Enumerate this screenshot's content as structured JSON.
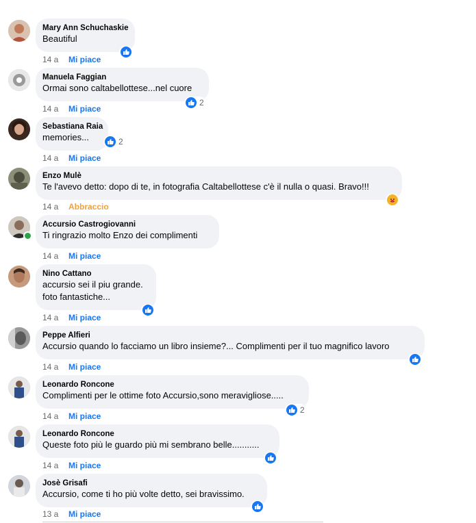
{
  "comments": [
    {
      "author": "Mary Ann Schuchaskie",
      "text": [
        "Beautiful"
      ],
      "time": "14 a",
      "action": "Mi piace",
      "reaction_count": "",
      "avatar_color": "#c9a48b"
    },
    {
      "author": "Manuela Faggian",
      "text": [
        "Ormai sono caltabellottese...nel cuore"
      ],
      "time": "14 a",
      "action": "Mi piace",
      "reaction_count": "2",
      "avatar_color": "#d8d8d8"
    },
    {
      "author": "Sebastiana Raia",
      "text": [
        "memories..."
      ],
      "time": "14 a",
      "action": "Mi piace",
      "reaction_count": "2",
      "avatar_color": "#6b4a3a"
    },
    {
      "author": "Enzo Mulè",
      "text": [
        "Te l'avevo detto: dopo di te, in fotografia Caltabellottese c'è il nulla o quasi. Bravo!!!"
      ],
      "time": "14 a",
      "action": "Abbraccio",
      "reaction_count": "",
      "avatar_color": "#7b7f6a"
    },
    {
      "author": "Accursio Castrogiovanni",
      "text": [
        "Ti ringrazio molto Enzo dei complimenti"
      ],
      "time": "14 a",
      "action": "Mi piace",
      "reaction_count": "",
      "avatar_color": "#5d5a57"
    },
    {
      "author": "Nino Cattano",
      "text": [
        "accursio sei il piu grande.",
        "foto fantastiche..."
      ],
      "time": "14 a",
      "action": "Mi piace",
      "reaction_count": "",
      "avatar_color": "#b98b6e"
    },
    {
      "author": "Peppe Alfieri",
      "text": [
        "Accursio quando lo facciamo un libro insieme?... Complimenti per il tuo magnifico lavoro"
      ],
      "time": "14 a",
      "action": "Mi piace",
      "reaction_count": "",
      "avatar_color": "#6e6e6e"
    },
    {
      "author": "Leonardo Roncone",
      "text": [
        "Complimenti per le ottime foto Accursio,sono meravigliose....."
      ],
      "time": "14 a",
      "action": "Mi piace",
      "reaction_count": "2",
      "avatar_color": "#3c5a8a"
    },
    {
      "author": "Leonardo Roncone",
      "text": [
        "Queste foto più le guardo più mi sembrano belle..........."
      ],
      "time": "14 a",
      "action": "Mi piace",
      "reaction_count": "",
      "avatar_color": "#3c5a8a"
    },
    {
      "author": "Josè Grisafi",
      "text": [
        "Accursio, come ti ho più volte detto, sei bravissimo."
      ],
      "time": "13 a",
      "action": "Mi piace",
      "reaction_count": "",
      "avatar_color": "#8a8f98"
    }
  ],
  "colors": {
    "like_blue": "#1877f2",
    "bubble_bg": "#f0f2f5",
    "meta_gray": "#65676b",
    "hug_orange": "#f0a13a"
  }
}
